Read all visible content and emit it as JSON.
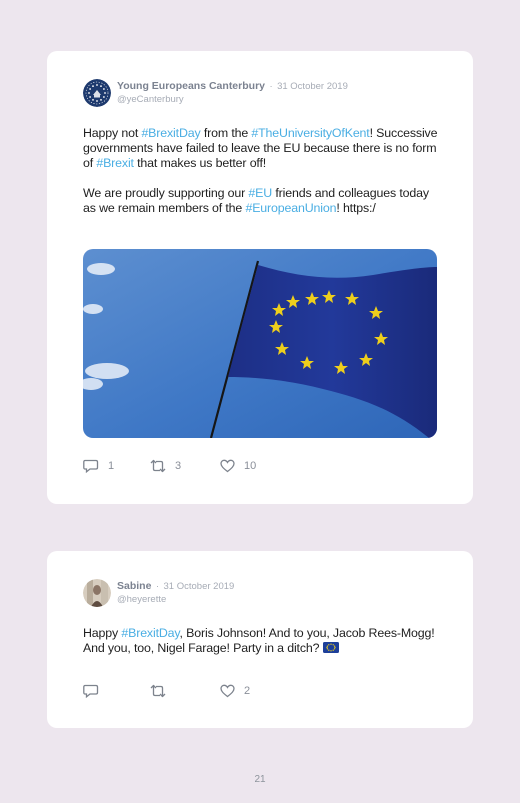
{
  "tweets": [
    {
      "author": "Young Europeans Canterbury",
      "dot": "·",
      "date": "31 October 2019",
      "handle": "@yeCanterbury",
      "body": {
        "p1": {
          "s1": "Happy not ",
          "t1": "#BrexitDay",
          "s2": " from the ",
          "t2": "#TheUniversityOfKent",
          "s3": "! Successive governments have failed to leave the EU because there is no form of ",
          "t3": "#Brexit",
          "s4": " that makes us better off!"
        },
        "p2": {
          "s1": "We are proudly supporting our ",
          "t1": "#EU",
          "s2": " friends and colleagues today as we remain members of the ",
          "t2": "#EuropeanUnion",
          "s3": "! https:/"
        }
      },
      "actions": {
        "replies": "1",
        "retweets": "3",
        "likes": "10"
      },
      "icons": {
        "reply": "reply-icon",
        "retweet": "retweet-icon",
        "like": "heart-icon",
        "avatar": "eu-stars-logo"
      }
    },
    {
      "author": "Sabine",
      "dot": "·",
      "date": "31 October 2019",
      "handle": "@heyerette",
      "body": {
        "s1": "Happy ",
        "t1": "#BrexitDay",
        "s2": ", Boris Johnson! And to you, Jacob Rees-Mogg! And you, too, Nigel Farage! Party in a ditch? "
      },
      "actions": {
        "replies": "",
        "retweets": "",
        "likes": "2"
      },
      "icons": {
        "reply": "reply-icon",
        "retweet": "retweet-icon",
        "like": "heart-icon",
        "emoji": "eu-flag-emoji"
      }
    }
  ],
  "page_number": "21",
  "colors": {
    "background": "#ede6ee",
    "card": "#ffffff",
    "hashtag": "#4aaee3",
    "eu_blue": "#1d3f99",
    "eu_star": "#f2d31b"
  }
}
